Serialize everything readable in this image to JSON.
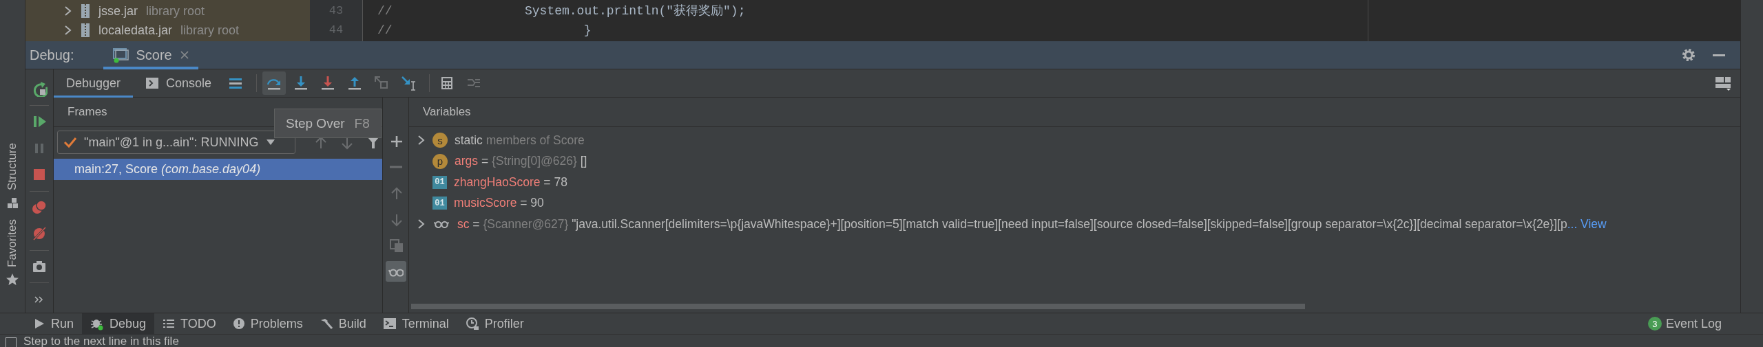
{
  "editor": {
    "tree": [
      {
        "name": "jsse.jar",
        "hint": "library root"
      },
      {
        "name": "localedata.jar",
        "hint": "library root"
      }
    ],
    "lines": [
      {
        "number": "43",
        "comment": "//",
        "code": "System.out.println(\"获得奖励\");"
      },
      {
        "number": "44",
        "comment": "//",
        "code": "}"
      }
    ]
  },
  "stripe": [
    {
      "label": "Structure"
    },
    {
      "label": "Favorites"
    }
  ],
  "debug": {
    "label": "Debug:",
    "tabs": [
      {
        "label": "Score",
        "selected": true
      }
    ]
  },
  "actions": [
    {
      "kind": "rerun",
      "disabled": false
    },
    {
      "kind": "resume",
      "disabled": false
    },
    {
      "kind": "pause",
      "disabled": true
    },
    {
      "kind": "stop",
      "disabled": false
    },
    {
      "kind": "breakpoints",
      "disabled": false
    },
    {
      "kind": "mute",
      "disabled": false
    },
    {
      "kind": "camera",
      "disabled": false
    },
    {
      "kind": "more",
      "disabled": false
    }
  ],
  "subtabs": [
    {
      "label": "Debugger",
      "selected": true
    },
    {
      "label": "Console",
      "selected": false
    }
  ],
  "toolbar": [
    {
      "kind": "layout",
      "disabled": false,
      "hovered": false
    },
    {
      "kind": "step-over",
      "disabled": false,
      "hovered": true
    },
    {
      "kind": "step-into",
      "disabled": false,
      "hovered": false
    },
    {
      "kind": "force-step-into",
      "disabled": false,
      "hovered": false
    },
    {
      "kind": "step-out",
      "disabled": false,
      "hovered": false
    },
    {
      "kind": "drop-frame",
      "disabled": true,
      "hovered": false
    },
    {
      "kind": "run-to-cursor",
      "disabled": false,
      "hovered": false
    },
    {
      "kind": "evaluate",
      "disabled": false,
      "hovered": false
    },
    {
      "kind": "trace",
      "disabled": true,
      "hovered": false
    }
  ],
  "tooltip": {
    "text": "Step Over",
    "shortcut": "F8"
  },
  "frames": {
    "title": "Frames",
    "thread": "\"main\"@1 in g...ain\": RUNNING",
    "nav": [
      {
        "kind": "up",
        "disabled": true
      },
      {
        "kind": "down",
        "disabled": true
      },
      {
        "kind": "filter",
        "disabled": false
      }
    ],
    "items": [
      {
        "method": "main:27, Score",
        "package": "(com.base.day04)",
        "selected": true
      }
    ]
  },
  "variables": {
    "title": "Variables",
    "side": [
      {
        "kind": "add",
        "disabled": false,
        "on": false
      },
      {
        "kind": "remove",
        "disabled": true,
        "on": false
      },
      {
        "kind": "up",
        "disabled": true,
        "on": false
      },
      {
        "kind": "down",
        "disabled": true,
        "on": false
      },
      {
        "kind": "copy",
        "disabled": true,
        "on": false
      },
      {
        "kind": "watches",
        "disabled": false,
        "on": true
      }
    ],
    "items": [
      {
        "kind": "static",
        "expandable": true,
        "badge": "s",
        "name": "static",
        "type": "members of Score"
      },
      {
        "kind": "param",
        "expandable": false,
        "badge": "p",
        "name": "args",
        "eq": "=",
        "type": "{String[0]@626}",
        "value": "[]"
      },
      {
        "kind": "field",
        "expandable": false,
        "badge": "01",
        "name": "zhangHaoScore",
        "eq": "=",
        "value": "78"
      },
      {
        "kind": "field",
        "expandable": false,
        "badge": "01",
        "name": "musicScore",
        "eq": "=",
        "value": "90"
      },
      {
        "kind": "watch",
        "expandable": true,
        "name": "sc",
        "eq": "=",
        "type": "{Scanner@627}",
        "value": "\"java.util.Scanner[delimiters=\\p{javaWhitespace}+][position=5][match valid=true][need input=false][source closed=false][skipped=false][group separator=\\x{2c}][decimal separator=\\x{2e}][p",
        "link": "... View"
      }
    ]
  },
  "tool_tabs": [
    {
      "kind": "run",
      "label": "Run",
      "selected": false
    },
    {
      "kind": "debug",
      "label": "Debug",
      "selected": true
    },
    {
      "kind": "todo",
      "label": "TODO",
      "selected": false
    },
    {
      "kind": "problems",
      "label": "Problems",
      "selected": false
    },
    {
      "kind": "build",
      "label": "Build",
      "selected": false
    },
    {
      "kind": "terminal",
      "label": "Terminal",
      "selected": false
    },
    {
      "kind": "profiler",
      "label": "Profiler",
      "selected": false
    }
  ],
  "event_log": {
    "label": "Event Log",
    "count": "3"
  },
  "status_bar": {
    "text": "Step to the next line in this file"
  }
}
